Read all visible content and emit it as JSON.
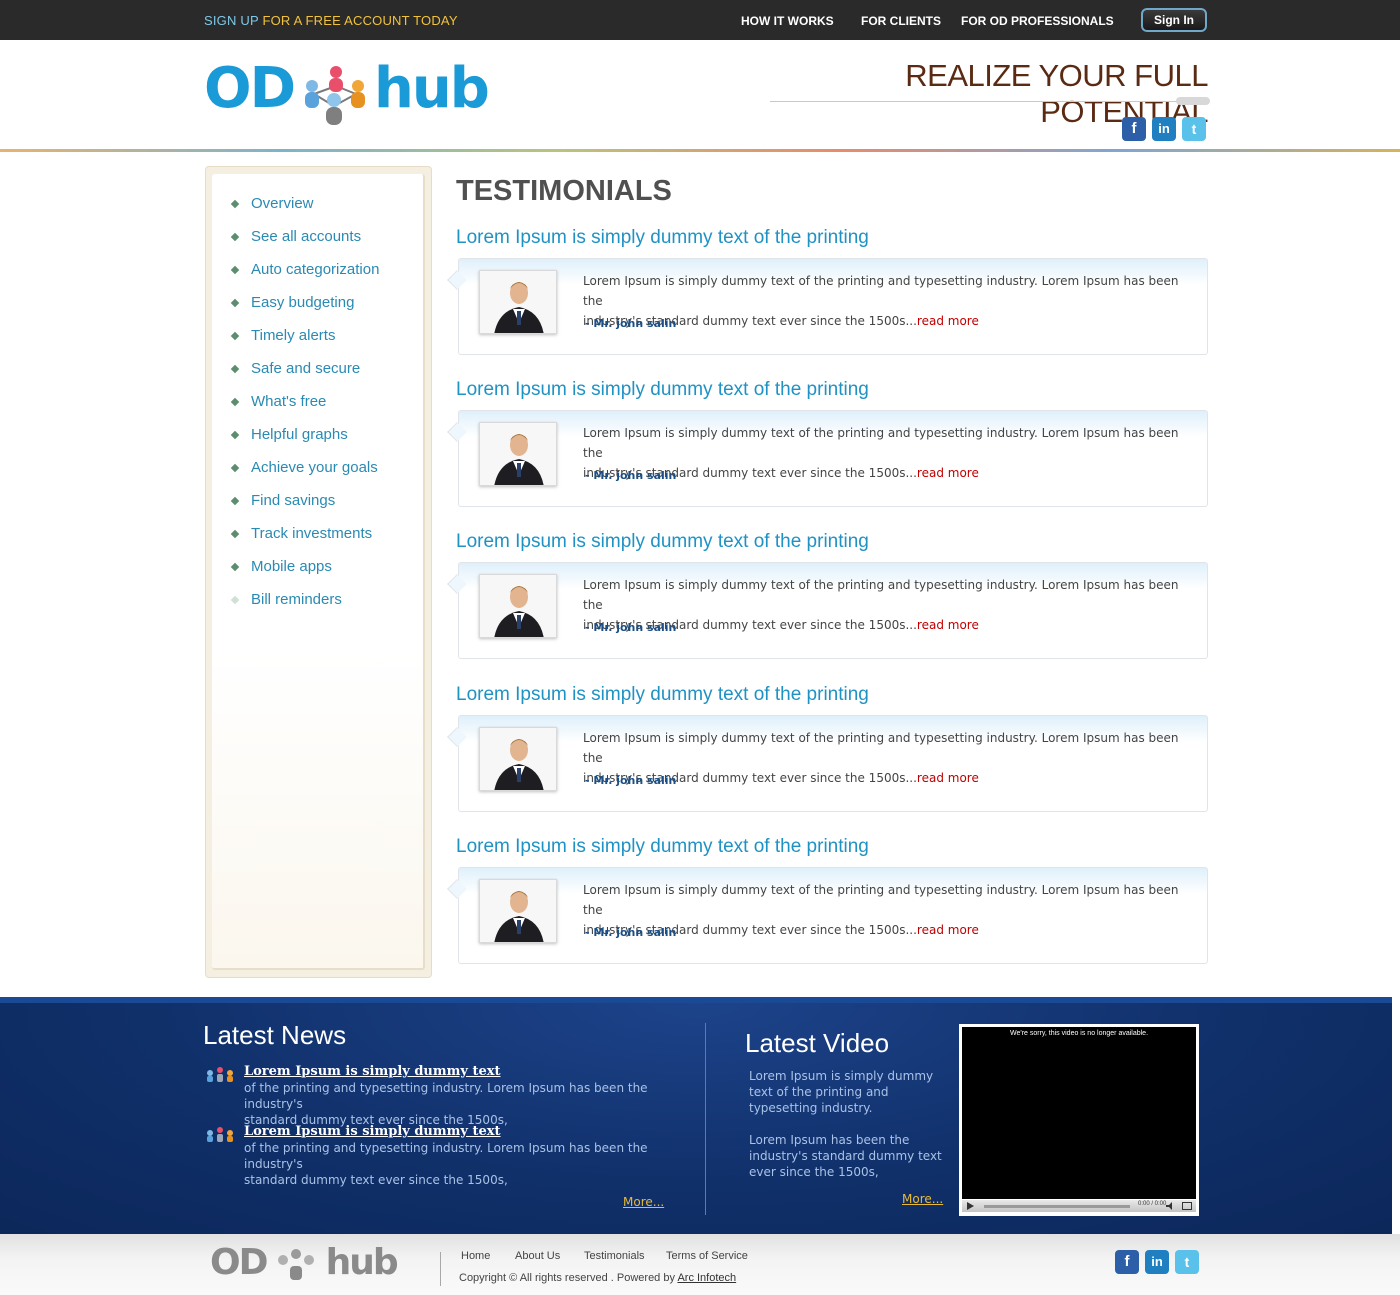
{
  "topbar": {
    "signup_part1": "SIGN UP",
    "signup_part2": "FOR A FREE ACCOUNT TODAY",
    "nav": [
      "HOW IT WORKS",
      "FOR CLIENTS",
      "FOR OD PROFESSIONALS"
    ],
    "signin": "Sign In"
  },
  "header": {
    "logo_left": "OD",
    "logo_right": "hub",
    "tagline": "REALIZE YOUR FULL POTENTIAL",
    "social": [
      "f",
      "in",
      "t"
    ]
  },
  "sidebar": {
    "items": [
      "Overview",
      "See all accounts",
      "Auto categorization",
      "Easy budgeting",
      "Timely alerts",
      "Safe and secure",
      "What's free",
      "Helpful graphs",
      "Achieve your goals",
      "Find savings",
      "Track investments",
      "Mobile apps",
      "Bill reminders"
    ]
  },
  "main": {
    "title": "TESTIMONIALS",
    "testimonials": [
      {
        "heading": "Lorem Ipsum is simply dummy text of the printing",
        "text1": "Lorem Ipsum is simply dummy text of the printing and typesetting industry.  Lorem Ipsum has been the",
        "text2": "industry's standard dummy text ever since the 1500s...",
        "more": "read more",
        "author": "- Mr. john salin"
      },
      {
        "heading": "Lorem Ipsum is simply dummy text of the printing",
        "text1": "Lorem Ipsum is simply dummy text of the printing and typesetting industry.  Lorem Ipsum has been the",
        "text2": "industry's standard dummy text ever since the 1500s...",
        "more": "read more",
        "author": "- Mr. john salin"
      },
      {
        "heading": "Lorem Ipsum is simply dummy text of the printing",
        "text1": "Lorem Ipsum is simply dummy text of the printing and typesetting industry.  Lorem Ipsum has been the",
        "text2": "industry's standard dummy text ever since the 1500s...",
        "more": "read more",
        "author": "- Mr. john salin"
      },
      {
        "heading": "Lorem Ipsum is simply dummy text of the printing",
        "text1": "Lorem Ipsum is simply dummy text of the printing and typesetting industry.  Lorem Ipsum has been the",
        "text2": "industry's standard dummy text ever since the 1500s...",
        "more": "read more",
        "author": "- Mr. john salin"
      },
      {
        "heading": "Lorem Ipsum is simply dummy text of the printing",
        "text1": "Lorem Ipsum is simply dummy text of the printing and typesetting industry.  Lorem Ipsum has been the",
        "text2": "industry's standard dummy text ever since the 1500s...",
        "more": "read more",
        "author": "- Mr. john salin"
      }
    ]
  },
  "footer": {
    "news_heading": "Latest News",
    "news": [
      {
        "title": "Lorem Ipsum is simply dummy text",
        "line1": "of the printing and typesetting industry. Lorem Ipsum has been the industry's",
        "line2": "standard dummy text ever since the 1500s,"
      },
      {
        "title": "Lorem Ipsum is simply dummy text",
        "line1": "of the printing and typesetting industry. Lorem Ipsum has been the industry's",
        "line2": "standard dummy text ever since the 1500s,"
      }
    ],
    "news_more": "More...",
    "video_heading": "Latest Video",
    "video_text1": "Lorem Ipsum is simply dummy text of the printing and typesetting industry.",
    "video_text2": "Lorem Ipsum has been the industry's standard dummy text ever since the 1500s,",
    "video_more": "More...",
    "video_message": "We're sorry, this video is no longer available.",
    "video_time": "0:00 / 0:00",
    "links": [
      "Home",
      "About Us",
      "Testimonials",
      "Terms of Service"
    ],
    "copyright": "Copyright ©   All rights reserved . Powered by ",
    "powered_by": "Arc Infotech"
  },
  "colors": {
    "topbar_bg": "#2a2a2a",
    "accent_blue": "#1f92c4",
    "tagline_brown": "#5a2a12",
    "footer_blue": "#10306a",
    "read_more_red": "#c00000",
    "more_gold": "#e9b937"
  }
}
